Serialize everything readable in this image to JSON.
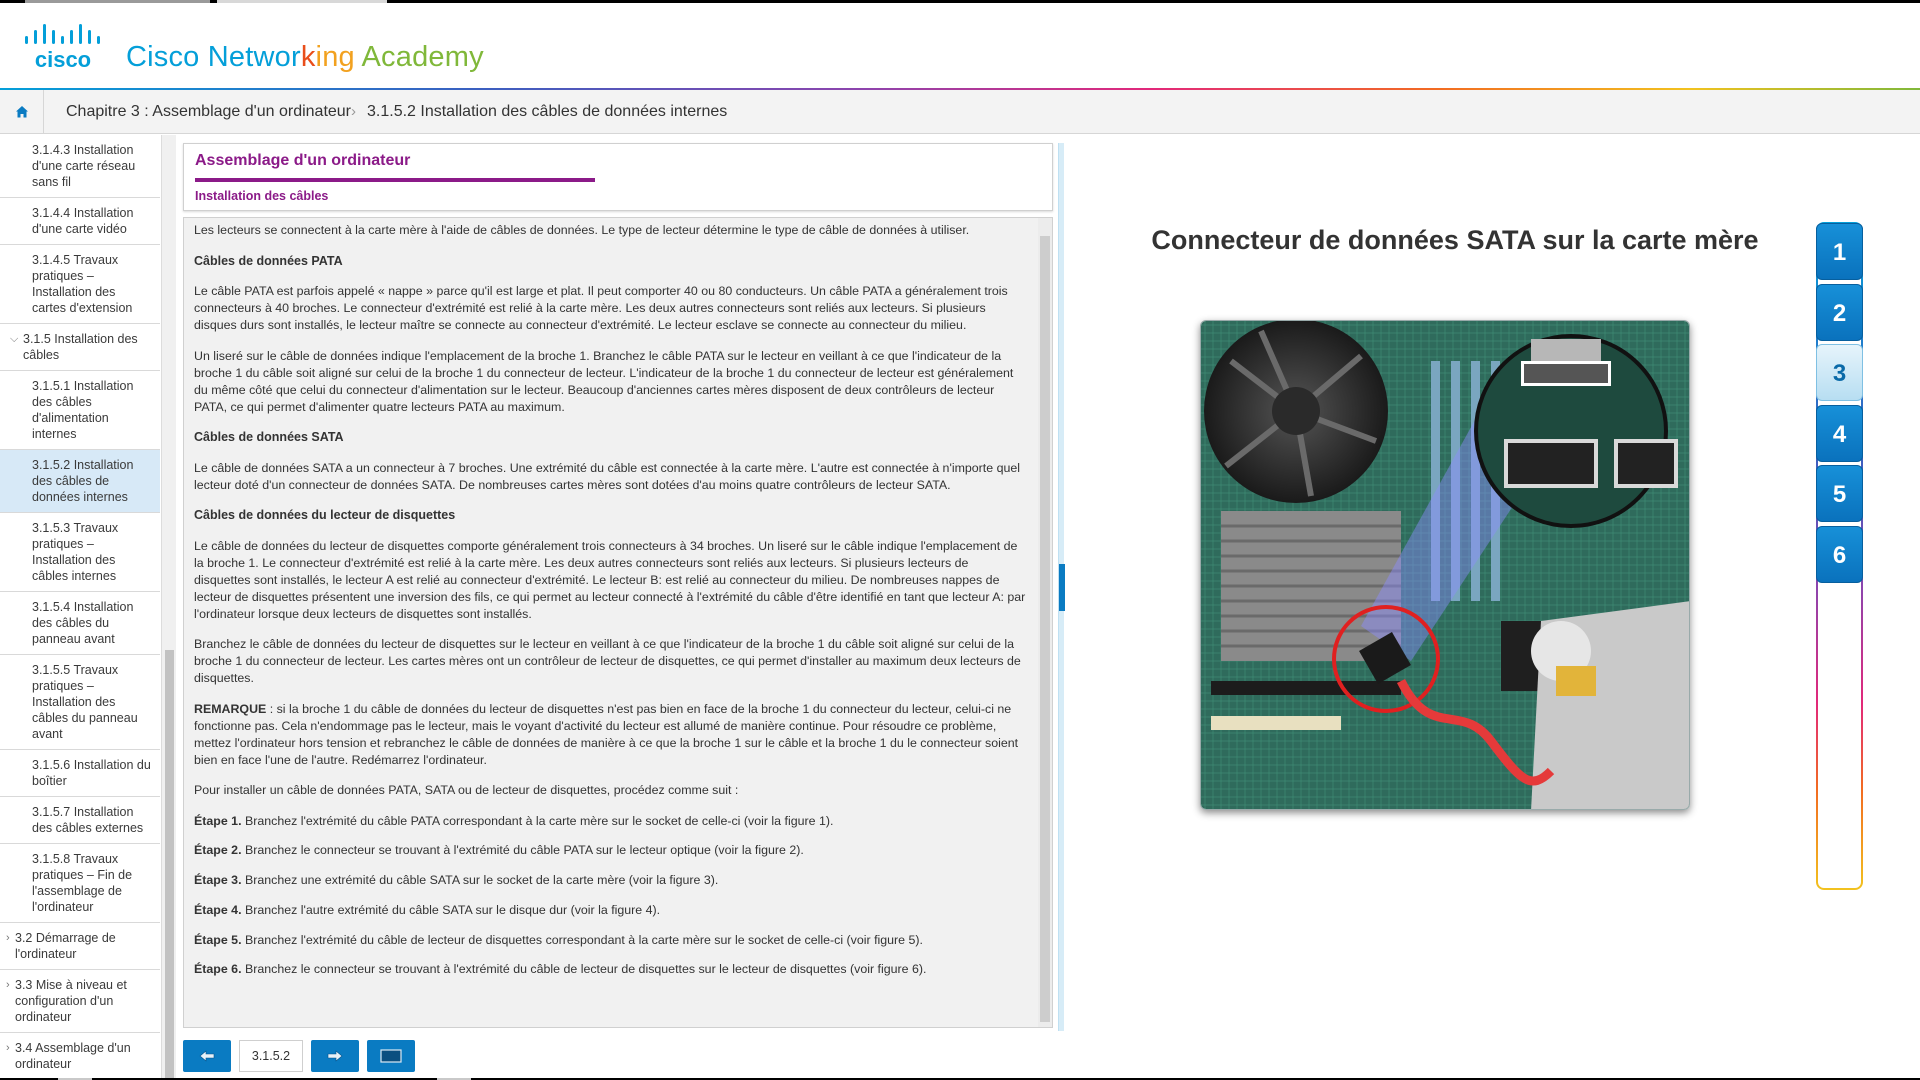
{
  "header": {
    "logo_text": "cisco",
    "brand": {
      "part1": "Cisco Networ",
      "part2": "k",
      "part3": "ing ",
      "part4": "Academy"
    },
    "colors": {
      "cisco_blue": "#049fd9",
      "orange": "#e94e1b",
      "yellow": "#f2a11f",
      "green": "#80b83a"
    }
  },
  "breadcrumb": {
    "home_icon": "home-icon",
    "chapter": "Chapitre 3 : Assemblage d'un ordinateur",
    "separator": "›",
    "current": "3.1.5.2 Installation des câbles de données internes"
  },
  "sidebar": {
    "items": [
      {
        "label": "3.1.4.3 Installation d'une carte réseau sans fil",
        "level": "sub"
      },
      {
        "label": "3.1.4.4 Installation d'une carte vidéo",
        "level": "sub"
      },
      {
        "label": "3.1.4.5 Travaux pratiques – Installation des cartes d'extension",
        "level": "sub"
      },
      {
        "label": "3.1.5 Installation des câbles",
        "level": "sec",
        "chevron": "⌵"
      },
      {
        "label": "3.1.5.1 Installation des câbles d'alimentation internes",
        "level": "sub"
      },
      {
        "label": "3.1.5.2 Installation des câbles de données internes",
        "level": "sub",
        "active": true
      },
      {
        "label": "3.1.5.3 Travaux pratiques – Installation des câbles internes",
        "level": "sub"
      },
      {
        "label": "3.1.5.4 Installation des câbles du panneau avant",
        "level": "sub"
      },
      {
        "label": "3.1.5.5 Travaux pratiques – Installation des câbles du panneau avant",
        "level": "sub"
      },
      {
        "label": "3.1.5.6 Installation du boîtier",
        "level": "sub"
      },
      {
        "label": "3.1.5.7 Installation des câbles externes",
        "level": "sub"
      },
      {
        "label": "3.1.5.8 Travaux pratiques – Fin de l'assemblage de l'ordinateur",
        "level": "sub"
      },
      {
        "label": "3.2 Démarrage de l'ordinateur",
        "level": "top",
        "chevron": "›"
      },
      {
        "label": "3.3 Mise à niveau et configuration d'un ordinateur",
        "level": "top",
        "chevron": "›"
      },
      {
        "label": "3.4 Assemblage d'un ordinateur",
        "level": "top",
        "chevron": "›"
      }
    ]
  },
  "article": {
    "title": "Assemblage d'un ordinateur",
    "subtitle": "Installation des câbles",
    "intro": "Les lecteurs se connectent à la carte mère à l'aide de câbles de données. Le type de lecteur détermine le type de câble de données à utiliser.",
    "pata_heading": "Câbles de données PATA",
    "pata_p1": "Le câble PATA est parfois appelé « nappe » parce qu'il est large et plat. Il peut comporter 40 ou 80 conducteurs. Un câble PATA a généralement trois connecteurs à 40 broches. Le connecteur d'extrémité est relié à la carte mère. Les deux autres connecteurs sont reliés aux lecteurs. Si plusieurs disques durs sont installés, le lecteur maître se connecte au connecteur d'extrémité. Le lecteur esclave se connecte au connecteur du milieu.",
    "pata_p2": "Un liseré sur le câble de données indique l'emplacement de la broche 1. Branchez le câble PATA sur le lecteur en veillant à ce que l'indicateur de la broche 1 du câble soit aligné sur celui de la broche 1 du connecteur de lecteur. L'indicateur de la broche 1 du connecteur de lecteur est généralement du même côté que celui du connecteur d'alimentation sur le lecteur. Beaucoup d'anciennes cartes mères disposent de deux contrôleurs de lecteur PATA, ce qui permet d'alimenter quatre lecteurs PATA au maximum.",
    "sata_heading": "Câbles de données SATA",
    "sata_p1": "Le câble de données SATA a un connecteur à 7 broches. Une extrémité du câble est connectée à la carte mère. L'autre est connectée à n'importe quel lecteur doté d'un connecteur de données SATA. De nombreuses cartes mères sont dotées d'au moins quatre contrôleurs de lecteur SATA.",
    "floppy_heading": "Câbles de données du lecteur de disquettes",
    "floppy_p1": "Le câble de données du lecteur de disquettes comporte généralement trois connecteurs à 34 broches. Un liseré sur le câble indique l'emplacement de la broche 1. Le connecteur d'extrémité est relié à la carte mère. Les deux autres connecteurs sont reliés aux lecteurs. Si plusieurs lecteurs de disquettes sont installés, le lecteur A est relié au connecteur d'extrémité. Le lecteur B: est relié au connecteur du milieu. De nombreuses nappes de lecteur de disquettes présentent une inversion des fils, ce qui permet au lecteur connecté à l'extrémité du câble d'être identifié en tant que lecteur A: par l'ordinateur lorsque deux lecteurs de disquettes sont installés.",
    "floppy_p2": "Branchez le câble de données du lecteur de disquettes sur le lecteur en veillant à ce que l'indicateur de la broche 1 du câble soit aligné sur celui de la broche 1 du connecteur de lecteur. Les cartes mères ont un contrôleur de lecteur de disquettes, ce qui permet d'installer au maximum deux lecteurs de disquettes.",
    "remark_label": "REMARQUE",
    "remark_text": " : si la broche 1 du câble de données du lecteur de disquettes n'est pas bien en face de la broche 1 du connecteur du lecteur, celui-ci ne fonctionne pas. Cela n'endommage pas le lecteur, mais le voyant d'activité du lecteur est allumé de manière continue. Pour résoudre ce problème, mettez l'ordinateur hors tension et rebranchez le câble de données de manière à ce que la broche 1 sur le câble et la broche 1 du le connecteur soient bien en face l'une de l'autre. Redémarrez l'ordinateur.",
    "steps_intro": "Pour installer un câble de données PATA, SATA ou de lecteur de disquettes, procédez comme suit :",
    "steps": [
      {
        "label": "Étape 1.",
        "text": " Branchez l'extrémité du câble PATA correspondant à la carte mère sur le socket de celle-ci (voir la figure 1)."
      },
      {
        "label": "Étape 2.",
        "text": " Branchez le connecteur se trouvant à l'extrémité du câble PATA sur le lecteur optique (voir la figure 2)."
      },
      {
        "label": "Étape 3.",
        "text": " Branchez une extrémité du câble SATA sur le socket de la carte mère (voir la figure 3)."
      },
      {
        "label": "Étape 4.",
        "text": " Branchez l'autre extrémité du câble SATA sur le disque dur (voir la figure 4)."
      },
      {
        "label": "Étape 5.",
        "text": " Branchez l'extrémité du câble de lecteur de disquettes correspondant à la carte mère sur le socket de celle-ci (voir figure 5)."
      },
      {
        "label": "Étape 6.",
        "text": " Branchez le connecteur se trouvant à l'extrémité du câble de lecteur de disquettes sur le lecteur de disquettes (voir figure 6)."
      }
    ]
  },
  "footer_nav": {
    "prev_icon": "arrow-left-icon",
    "page": "3.1.5.2",
    "next_icon": "arrow-right-icon",
    "screen_icon": "media-screen-icon",
    "accent": "#0a7bc2"
  },
  "figure": {
    "title": "Connecteur de données SATA sur la carte mère",
    "buttons": [
      "1",
      "2",
      "3",
      "4",
      "5",
      "6"
    ],
    "active_index": 2
  }
}
